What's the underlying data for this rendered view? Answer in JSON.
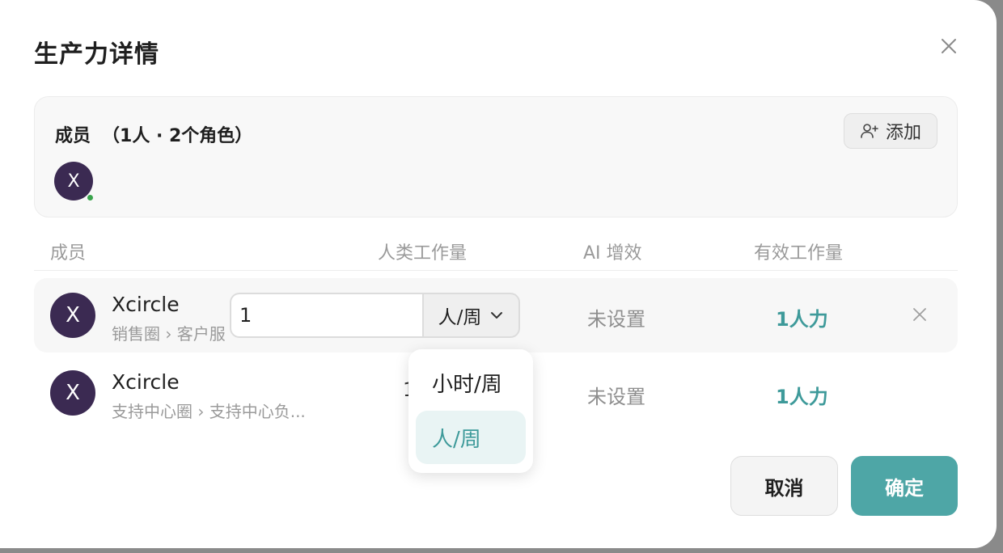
{
  "dialog": {
    "title": "生产力详情",
    "close_icon": "close-icon"
  },
  "members": {
    "heading": "成员",
    "count": "（1人 · 2个角色）",
    "add_label": "添加",
    "add_icon": "user-plus-icon",
    "avatar_letter": "X",
    "online_color": "#3aa44d"
  },
  "table": {
    "headers": [
      "成员",
      "人类工作量",
      "AI 增效",
      "有效工作量"
    ],
    "rows": [
      {
        "avatar": "X",
        "name": "Xcircle",
        "path": "销售圈 › 客户服",
        "workload_value": "1",
        "unit": "人/周",
        "ai": "未设置",
        "effective": "1人力"
      },
      {
        "avatar": "X",
        "name": "Xcircle",
        "path": "支持中心圈 › 支持中心负...",
        "workload_value": "1",
        "ai": "未设置",
        "effective": "1人力"
      }
    ]
  },
  "unit_dropdown": {
    "options": [
      "小时/周",
      "人/周"
    ],
    "selected": "人/周"
  },
  "footer": {
    "cancel": "取消",
    "confirm": "确定"
  },
  "colors": {
    "accent": "#4ea6a6",
    "accent_text": "#3e9a9a",
    "avatar_bg": "#3b2a52"
  }
}
